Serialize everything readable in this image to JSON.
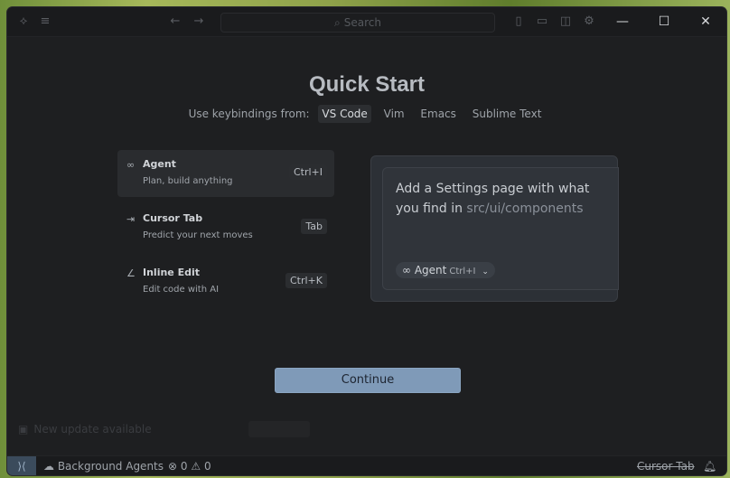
{
  "titlebar": {
    "search_placeholder": "Search"
  },
  "window_controls": {
    "minimize": "—",
    "maximize": "☐",
    "close": "✕"
  },
  "main": {
    "title": "Quick Start",
    "keybindings_label": "Use keybindings from:",
    "keybinding_options": [
      "VS Code",
      "Vim",
      "Emacs",
      "Sublime Text"
    ],
    "selected_keybinding": "VS Code",
    "features": [
      {
        "icon": "infinity-icon",
        "name": "Agent",
        "desc": "Plan, build anything",
        "key": "Ctrl+I",
        "active": true
      },
      {
        "icon": "tab-arrow-icon",
        "name": "Cursor Tab",
        "desc": "Predict your next moves",
        "key": "Tab",
        "active": false
      },
      {
        "icon": "pencil-icon",
        "name": "Inline Edit",
        "desc": "Edit code with AI",
        "key": "Ctrl+K",
        "active": false
      }
    ],
    "preview": {
      "text_before": "Add a Settings page with what you find in ",
      "path": "src/ui/components",
      "chip_label": "Agent",
      "chip_key": "Ctrl+I"
    },
    "continue_label": "Continue",
    "notice_text": "New update available"
  },
  "statusbar": {
    "background_agents": "Background Agents",
    "errors": "0",
    "warnings": "0",
    "cursor_tab": "Cursor Tab"
  }
}
